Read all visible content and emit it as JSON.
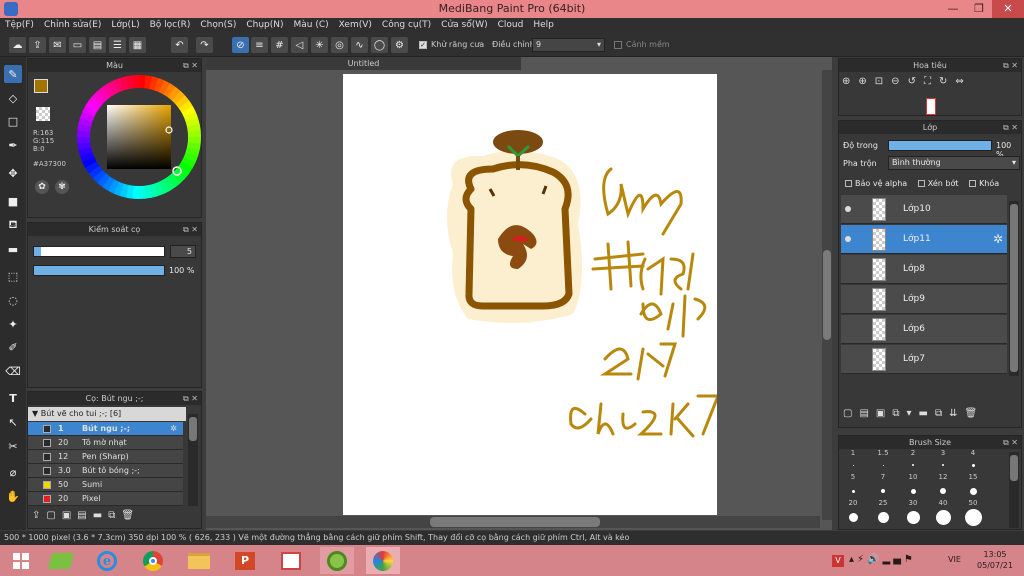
{
  "window": {
    "title": "MediBang Paint Pro (64bit)"
  },
  "menu": [
    "Tệp(F)",
    "Chỉnh sửa(E)",
    "Lớp(L)",
    "Bộ lọc(R)",
    "Chọn(S)",
    "Chụp(N)",
    "Màu (C)",
    "Xem(V)",
    "Công cụ(T)",
    "Cửa sổ(W)",
    "Cloud",
    "Help"
  ],
  "toolbar": {
    "antialias_label": "Khử răng cưa",
    "adjust_label": "Điều chỉnh",
    "adjust_value": "9",
    "warning_label": "Cảnh mềm"
  },
  "color_panel": {
    "title": "Màu",
    "r": "R:163",
    "g": "G:115",
    "b": "B:0",
    "hex": "#A37300",
    "main_color": "#A37300"
  },
  "brush_control": {
    "title": "Kiểm soát cọ",
    "size": "5",
    "opacity_label": "100 %",
    "opacity": 1.0,
    "size_fraction": 0.05
  },
  "brush_panel": {
    "title": "Cọ: Bút ngu ;-;",
    "group": "Bút vẽ cho tui ;-; [6]",
    "items": [
      {
        "size": "1",
        "name": "Bút ngu ;-;",
        "color": "#2a2a2a",
        "selected": true
      },
      {
        "size": "20",
        "name": "Tô mờ nhạt",
        "color": "#2a2a2a",
        "selected": false
      },
      {
        "size": "12",
        "name": "Pen (Sharp)",
        "color": "#2a2a2a",
        "selected": false
      },
      {
        "size": "3.0",
        "name": "Bút tô bóng ;-;",
        "color": "#2a2a2a",
        "selected": false
      },
      {
        "size": "50",
        "name": "Sumi",
        "color": "#f0d800",
        "selected": false
      },
      {
        "size": "20",
        "name": "Pixel",
        "color": "#e02020",
        "selected": false
      }
    ]
  },
  "canvas": {
    "tab_title": "Untitled"
  },
  "navigator": {
    "title": "Hoa tiêu"
  },
  "layer_panel": {
    "title": "Lớp",
    "opacity_label": "Độ trong",
    "opacity_value": "100 %",
    "opacity": 1.0,
    "blend_label": "Pha trộn",
    "blend_value": "Bình thường",
    "protect_alpha": "Bảo vệ alpha",
    "clipping": "Xén bớt",
    "lock": "Khóa",
    "layers": [
      {
        "name": "Lớp10",
        "visible": true,
        "selected": false
      },
      {
        "name": "Lớp11",
        "visible": true,
        "selected": true
      },
      {
        "name": "Lớp8",
        "visible": false,
        "selected": false
      },
      {
        "name": "Lớp9",
        "visible": false,
        "selected": false
      },
      {
        "name": "Lớp6",
        "visible": false,
        "selected": false
      },
      {
        "name": "Lớp7",
        "visible": false,
        "selected": false
      }
    ]
  },
  "brush_size": {
    "title": "Brush Size",
    "sizes": [
      "1",
      "1.5",
      "2",
      "3",
      "4",
      "5",
      "7",
      "10",
      "12",
      "15",
      "20",
      "25",
      "30",
      "40",
      "50"
    ]
  },
  "status": {
    "text": "500 * 1000 pixel  (3.6 * 7.3cm)  350 dpi  100 %  ( 626, 233 )  Vẽ một đường thẳng bằng cách giữ phím Shift, Thay đổi cỡ cọ bằng cách giữ phím Ctrl, Alt và kéo"
  },
  "taskbar": {
    "lang": "VIE",
    "time": "13:05",
    "date": "05/07/21"
  }
}
